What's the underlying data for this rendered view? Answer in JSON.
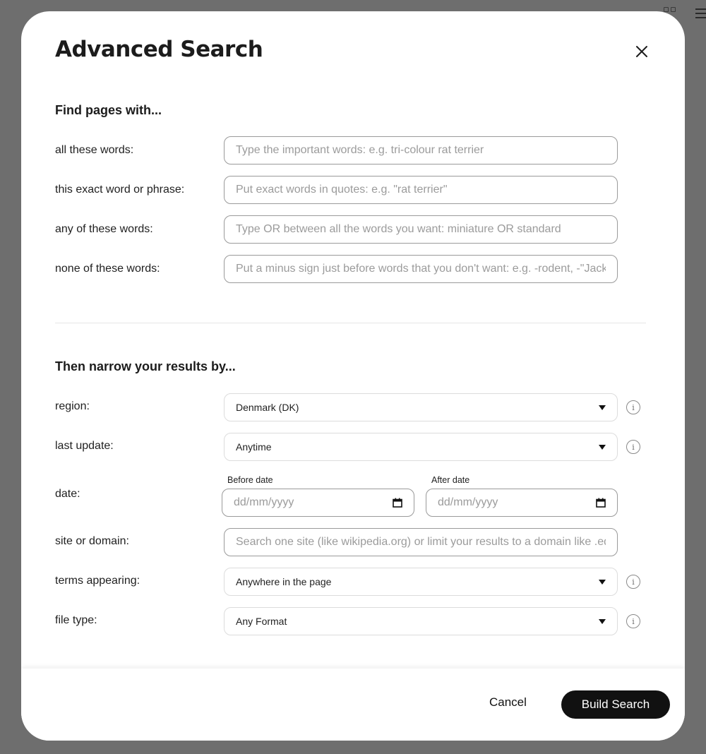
{
  "modal": {
    "title": "Advanced Search",
    "close_icon": "close-icon"
  },
  "find_section": {
    "title": "Find pages with...",
    "rows": [
      {
        "label": "all these words:",
        "placeholder": "Type the important words: e.g. tri-colour rat terrier",
        "value": ""
      },
      {
        "label": "this exact word or phrase:",
        "placeholder": "Put exact words in quotes: e.g. \"rat terrier\"",
        "value": ""
      },
      {
        "label": "any of these words:",
        "placeholder": "Type OR between all the words you want: miniature OR standard",
        "value": ""
      },
      {
        "label": "none of these words:",
        "placeholder": "Put a minus sign just before words that you don't want: e.g. -rodent, -\"Jack Russell\"",
        "value": ""
      }
    ]
  },
  "narrow_section": {
    "title": "Then narrow your results by...",
    "region": {
      "label": "region:",
      "value": "Denmark (DK)"
    },
    "last_update": {
      "label": "last update:",
      "value": "Anytime"
    },
    "date": {
      "label": "date:",
      "before_caption": "Before date",
      "after_caption": "After date",
      "before_placeholder": "dd/mm/yyyy",
      "after_placeholder": "dd/mm/yyyy"
    },
    "site": {
      "label": "site or domain:",
      "placeholder": "Search one site (like wikipedia.org) or limit your results to a domain like .edu, .org or .gov",
      "value": ""
    },
    "terms": {
      "label": "terms appearing:",
      "value": "Anywhere in the page"
    },
    "file_type": {
      "label": "file type:",
      "value": "Any Format"
    }
  },
  "footer": {
    "cancel_label": "Cancel",
    "build_label": "Build Search"
  },
  "icons": [
    "close-icon",
    "info-icon",
    "calendar-icon",
    "caret-down-icon",
    "grid-icon",
    "menu-icon"
  ]
}
